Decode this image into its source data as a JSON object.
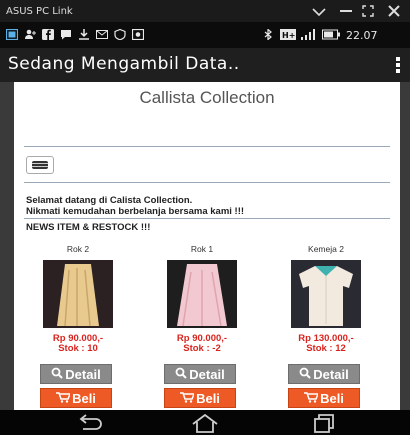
{
  "window": {
    "title": "ASUS PC Link"
  },
  "status_bar": {
    "time": "22.07"
  },
  "app_bar": {
    "title": "Sedang Mengambil Data.."
  },
  "site": {
    "title": "Callista Collection",
    "welcome_line1": "Selamat datang di Calista Collection.",
    "welcome_line2": "Nikmati kemudahan berbelanja bersama kami !!!",
    "news_heading": "NEWS ITEM & RESTOCK !!!"
  },
  "products": [
    {
      "name": "Rok 2",
      "price": "Rp 90.000,-",
      "stock": "Stok : 10",
      "detail_label": "Detail",
      "buy_label": "Beli"
    },
    {
      "name": "Rok 1",
      "price": "Rp 90.000,-",
      "stock": "Stok : -2",
      "detail_label": "Detail",
      "buy_label": "Beli"
    },
    {
      "name": "Kemeja 2",
      "price": "Rp 130.000,-",
      "stock": "Stok : 12",
      "detail_label": "Detail",
      "buy_label": "Beli"
    }
  ],
  "icons": {
    "menu": "hamburger-icon",
    "detail": "magnifier-icon",
    "buy": "cart-icon",
    "back": "back-icon",
    "home": "home-icon",
    "recents": "recent-apps-icon"
  },
  "colors": {
    "price": "#d9231e",
    "detail_button": "#8a8a8a",
    "buy_button": "#ee5a26"
  }
}
